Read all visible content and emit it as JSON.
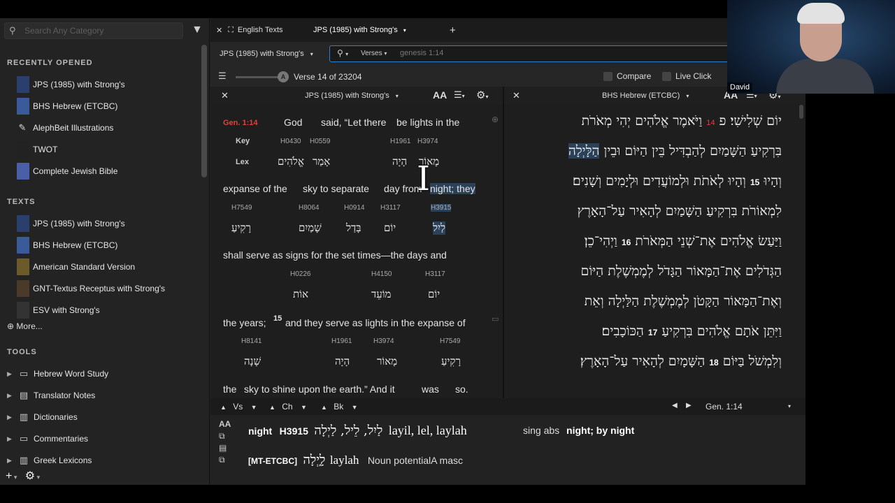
{
  "sidebar": {
    "search_placeholder": "Search Any Category",
    "recently_opened_title": "RECENTLY OPENED",
    "recently_opened": [
      {
        "label": "JPS (1985) with Strong's",
        "color": "#2a3f6b"
      },
      {
        "label": "BHS Hebrew (ETCBC)",
        "color": "#3a5a9a"
      },
      {
        "label": "AlephBeit Illustrations",
        "icon": "✎"
      },
      {
        "label": "TWOT",
        "color": "#222"
      },
      {
        "label": "Complete Jewish Bible",
        "color": "#4a5fa8"
      }
    ],
    "texts_title": "TEXTS",
    "texts": [
      {
        "label": "JPS (1985) with Strong's",
        "color": "#2a3f6b"
      },
      {
        "label": "BHS Hebrew (ETCBC)",
        "color": "#3a5a9a"
      },
      {
        "label": "American Standard Version",
        "color": "#6b5a2a"
      },
      {
        "label": "GNT-Textus Receptus with Strong's",
        "color": "#4b3a2a"
      },
      {
        "label": "ESV with Strong's",
        "color": "#333"
      }
    ],
    "more_label": "More...",
    "tools_title": "TOOLS",
    "tools": [
      {
        "label": "Hebrew Word Study",
        "icon": "▭"
      },
      {
        "label": "Translator Notes",
        "icon": "▤"
      },
      {
        "label": "Dictionaries",
        "icon": "▥"
      },
      {
        "label": "Commentaries",
        "icon": "▭"
      },
      {
        "label": "Greek Lexicons",
        "icon": "▥"
      }
    ]
  },
  "tabs": {
    "english_texts": "English Texts",
    "jps_tab": "JPS (1985) with Strong's",
    "add": "+"
  },
  "toolbar": {
    "version_select": "JPS (1985) with Strong's",
    "search_mode": "Verses",
    "search_query": "genesis 1:14",
    "verse_position": "Verse 14 of 23204",
    "compare": "Compare",
    "live_click": "Live Click"
  },
  "left_pane": {
    "title": "JPS (1985) with Strong's",
    "reference": "Gen. 1:14",
    "key_label": "Key",
    "lex_label": "Lex",
    "line1": {
      "words": [
        "God",
        "said, “Let there",
        "be lights in the"
      ],
      "strongs": [
        "H0430",
        "H0559",
        "H1961",
        "H3974"
      ],
      "hebrew": [
        "אֱלֹהִים",
        "אָמַר",
        "הָיָה",
        "מָאוֹר"
      ]
    },
    "line2": {
      "words": [
        "expanse of the",
        "sky to separate",
        "day from",
        "night; they"
      ],
      "strongs": [
        "H7549",
        "H8064",
        "H0914",
        "H3117",
        "H3915"
      ],
      "hebrew": [
        "רָקִיעַ",
        "שָׁמַיִם",
        "בָּדַל",
        "יוֹם",
        "לַיִל"
      ]
    },
    "line3": {
      "words": [
        "shall serve as signs for the set times—the days and"
      ],
      "strongs": [
        "H0226",
        "H4150",
        "H3117"
      ],
      "hebrew": [
        "אוֹת",
        "מוֹעֵד",
        "יוֹם"
      ]
    },
    "line4": {
      "words": [
        "the years;",
        "15",
        "and they serve as lights in the expanse of"
      ],
      "strongs": [
        "H8141",
        "H1961",
        "H3974",
        "H7549"
      ],
      "hebrew": [
        "שָׁנָה",
        "הָיָה",
        "מָאוֹר",
        "רָקִיעַ"
      ]
    },
    "line5": {
      "words": [
        "the",
        "sky to shine upon the earth.” And it",
        "was",
        "so."
      ]
    }
  },
  "right_pane": {
    "title": "BHS Hebrew (ETCBC)",
    "lines": [
      {
        "pre": "וַיֹּאמֶר אֱלֹהִים יְהִי מְאֹרֹת",
        "num": "14",
        "post": "יוֹם שְׁלִישִׁי׃ פ"
      },
      {
        "pre": "בִּרְקִיעַ הַשָּׁמַיִם לְהַבְדִּיל בֵּין הַיּוֹם וּבֵין",
        "hl": "הַלָּיְלָה"
      },
      {
        "pre": "וְהָיוּ לְאֹתֹת וּלְמוֹעֲדִים וּלְיָמִים וְשָׁנִים׃",
        "numw": "15",
        "post": "וְהָיוּ"
      },
      {
        "pre": "לִמְאוֹרֹת בִּרְקִיעַ הַשָּׁמַיִם לְהָאִיר עַל־הָאָרֶץ"
      },
      {
        "pre": "וַיְהִי־כֵן׃",
        "numw": "16",
        "post": "וַיַּעַשׂ אֱלֹהִים אֶת־שְׁנֵי הַמְּאֹרֹת"
      },
      {
        "pre": "הַגְּדֹלִים אֶת־הַמָּאוֹר הַגָּדֹל לְמֶמְשֶׁלֶת הַיּוֹם"
      },
      {
        "pre": "וְאֶת־הַמָּאוֹר הַקָּטֹן לְמֶמְשֶׁלֶת הַלַּיְלָה וְאֵת"
      },
      {
        "pre": "הַכּוֹכָבִים׃",
        "numw": "17",
        "post": "וַיִּתֵּן אֹתָם אֱלֹהִים בִּרְקִיעַ"
      },
      {
        "pre": "הַשָּׁמָיִם לְהָאִיר עַל־הָאָרֶץ׃",
        "numw": "18",
        "post": "וְלִמְשֹׁל בַּיּוֹם"
      }
    ]
  },
  "navbar": {
    "vs": "Vs",
    "ch": "Ch",
    "bk": "Bk",
    "reference": "Gen. 1:14"
  },
  "info": {
    "word": "night",
    "strongs": "H3915",
    "hebrew": "לַיִל, לֵיל, לַיְלָה",
    "translit": "layil, lel, laylah",
    "morph": "sing abs",
    "gloss": "night; by night",
    "source": "[MT-ETCBC]",
    "hebrew2": "לָ֑יְלָה",
    "translit2": "laylah",
    "pos": "Noun potentialA masc"
  },
  "webcam": {
    "name": "David"
  }
}
